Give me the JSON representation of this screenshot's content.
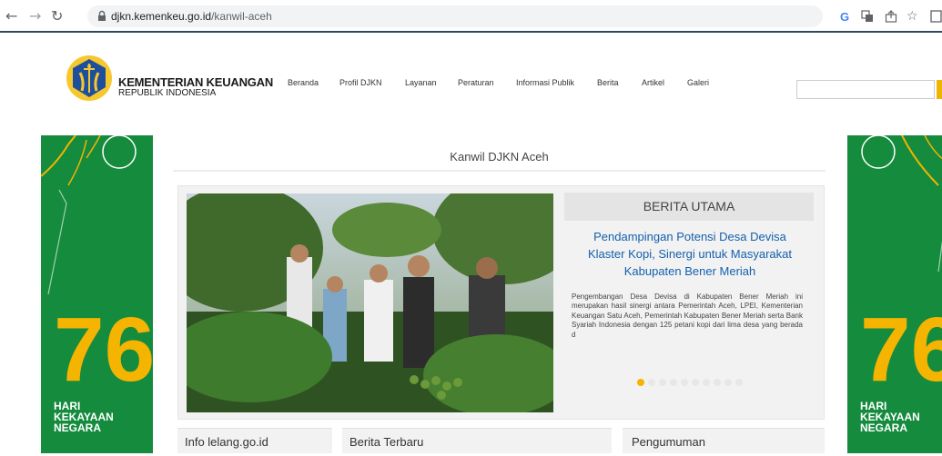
{
  "browser": {
    "url_domain": "djkn.kemenkeu.go.id",
    "url_path": "/kanwil-aceh",
    "icons": [
      "back-icon",
      "forward-icon",
      "reload-icon",
      "lock-icon",
      "google-icon",
      "translate-icon",
      "share-icon",
      "star-icon",
      "tab-icon"
    ]
  },
  "header": {
    "brand_line1": "KEMENTERIAN KEUANGAN",
    "brand_line2": "REPUBLIK INDONESIA",
    "menu": [
      "Beranda",
      "Profil DJKN",
      "Layanan",
      "Peraturan",
      "Informasi Publik",
      "Berita",
      "Artikel",
      "Galeri"
    ]
  },
  "banner": {
    "number": "76",
    "line1": "HARI",
    "line2": "KEKAYAAN",
    "line3": "NEGARA"
  },
  "main": {
    "page_title": "Kanwil DJKN Aceh",
    "feature": {
      "heading": "BERITA UTAMA",
      "title": "Pendampingan Potensi Desa Devisa Klaster Kopi, Sinergi untuk Masyarakat Kabupaten Bener Meriah",
      "body": "Pengembangan Desa Devisa di Kabupaten Bener Meriah ini merupakan hasil sinergi antara Pemerintah Aceh, LPEI, Kementerian Keuangan Satu Aceh, Pemerintah Kabupaten Bener Meriah serta Bank Syariah Indonesia dengan 125 petani kopi dari lima desa yang berada d",
      "slides_total": 10,
      "slide_active": 1
    },
    "sections": [
      "Info lelang.go.id",
      "Berita Terbaru",
      "Pengumuman"
    ]
  },
  "colors": {
    "banner_green": "#158b3e",
    "accent_yellow": "#f4b400",
    "link_blue": "#1560ad"
  }
}
